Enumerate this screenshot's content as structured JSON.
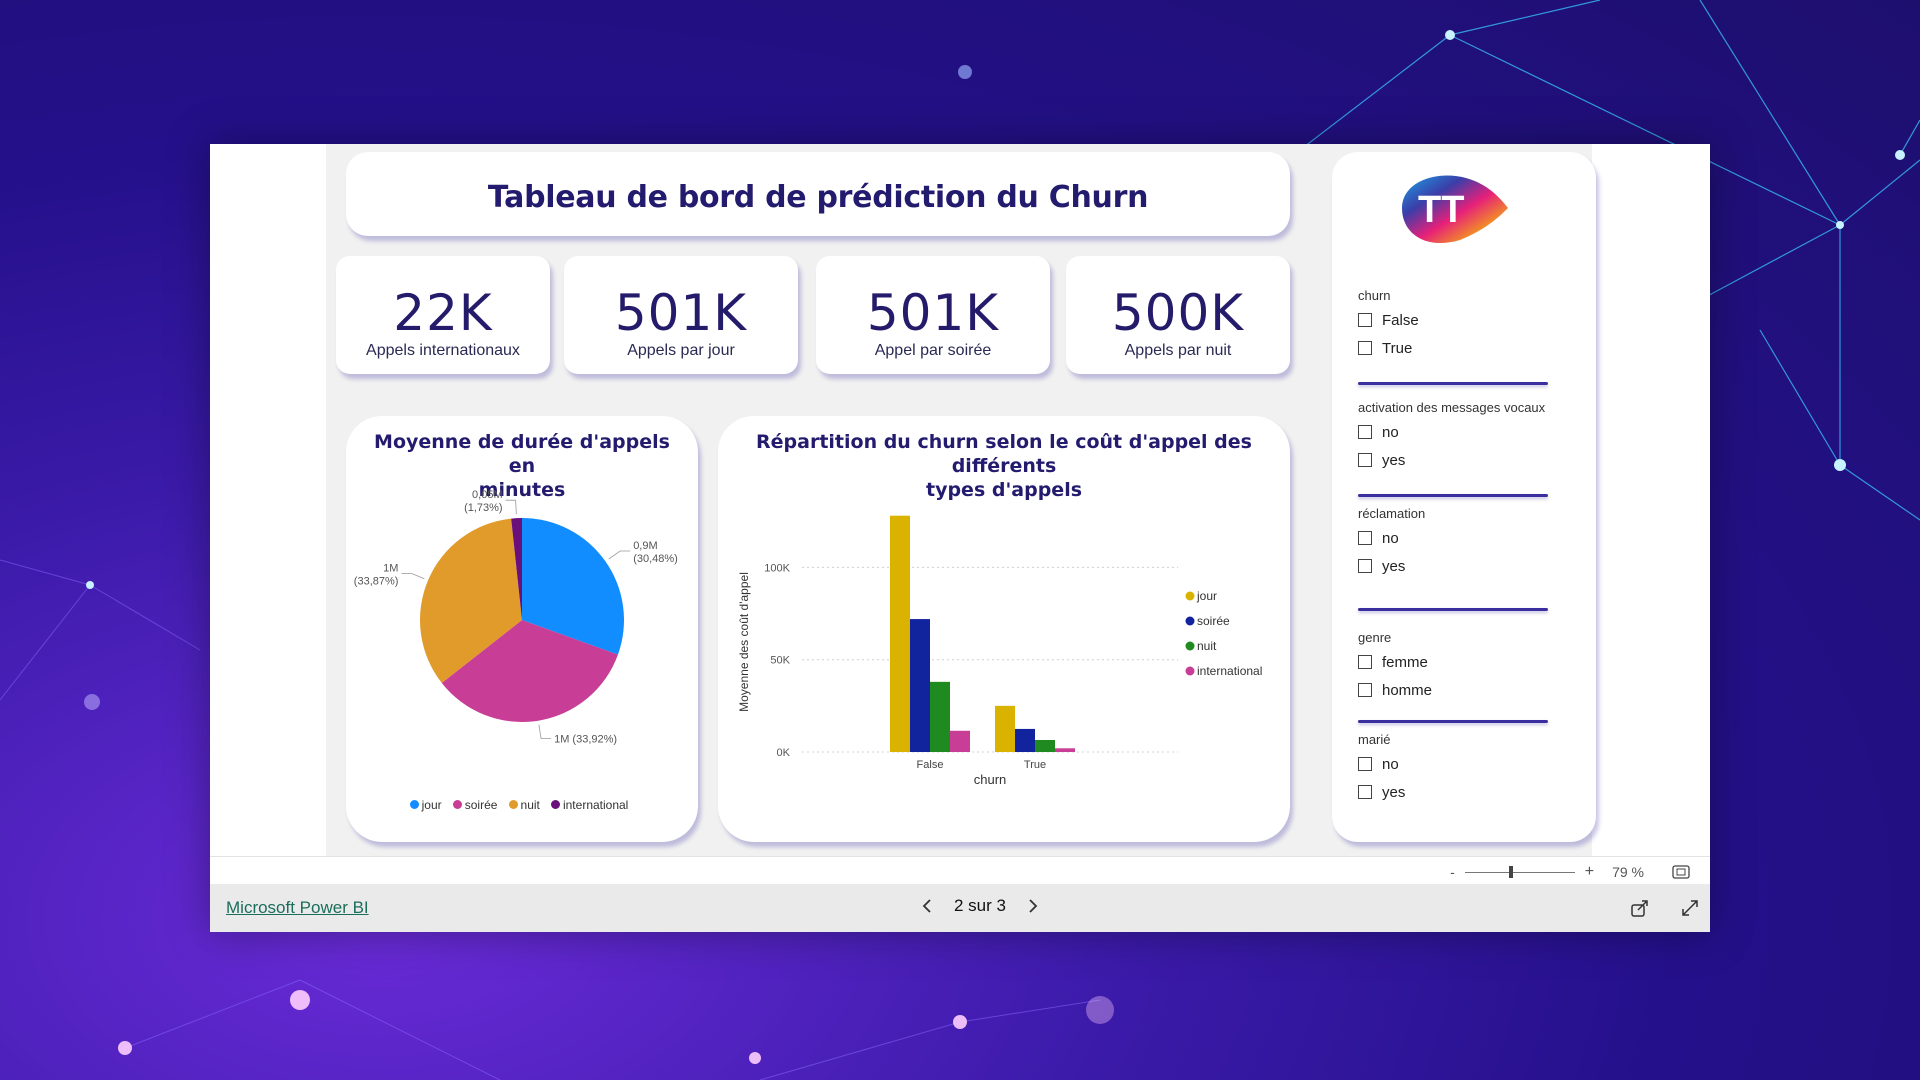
{
  "dashboard": {
    "title": "Tableau de bord de prédiction du Churn"
  },
  "kpis": [
    {
      "value": "22K",
      "label": "Appels internationaux"
    },
    {
      "value": "501K",
      "label": "Appels par jour"
    },
    {
      "value": "501K",
      "label": "Appel par soirée"
    },
    {
      "value": "500K",
      "label": "Appels par nuit"
    }
  ],
  "pie_card": {
    "title_line1": "Moyenne de durée d'appels en",
    "title_line2": "minutes"
  },
  "bar_card": {
    "title_line1": "Répartition du churn selon le coût d'appel des différents",
    "title_line2": "types d'appels"
  },
  "logo": {
    "text": "TT",
    "icon": "tunisie-telecom-logo"
  },
  "slicers": [
    {
      "title": "churn",
      "options": [
        "False",
        "True"
      ]
    },
    {
      "title": "activation des messages vocaux",
      "options": [
        "no",
        "yes"
      ]
    },
    {
      "title": "réclamation",
      "options": [
        "no",
        "yes"
      ]
    },
    {
      "title": "genre",
      "options": [
        "femme",
        "homme"
      ]
    },
    {
      "title": "marié",
      "options": [
        "no",
        "yes"
      ]
    }
  ],
  "footer": {
    "powerbi_link": "Microsoft Power BI",
    "page_indicator": "2 sur 3",
    "zoom_minus": "-",
    "zoom_plus": "+",
    "zoom_level": "79 %",
    "zoom_fraction": 0.4,
    "prev_icon": "chevron-left-icon",
    "next_icon": "chevron-right-icon",
    "share_icon": "share-icon",
    "fullscreen_icon": "expand-icon",
    "fit_icon": "fit-page-icon"
  },
  "colors": {
    "jour": "#118dff",
    "soiree": "#c83d95",
    "nuit": "#e09b2a",
    "international": "#6b0f7a",
    "bar_jour": "#d9b300",
    "bar_soiree": "#12239e",
    "bar_nuit": "#1f8a1f",
    "bar_international": "#c83d95",
    "title": "#231b6e"
  },
  "chart_data": [
    {
      "type": "pie",
      "title": "Moyenne de durée d'appels en minutes",
      "categories": [
        "jour",
        "soirée",
        "nuit",
        "international"
      ],
      "values": [
        0.9,
        1.0,
        1.0,
        0.05
      ],
      "percent": [
        30.48,
        33.92,
        33.87,
        1.73
      ],
      "data_labels": [
        "0,9M\n(30,48%)",
        "1M (33,92%)",
        "1M\n(33,87%)",
        "0,05M\n(1,73%)"
      ],
      "legend": [
        "jour",
        "soirée",
        "nuit",
        "international"
      ],
      "legend_position": "bottom"
    },
    {
      "type": "bar",
      "title": "Répartition du churn selon le coût d'appel des différents types d'appels",
      "xlabel": "churn",
      "ylabel": "Moyenne des coût d'appel",
      "categories": [
        "False",
        "True"
      ],
      "series": [
        {
          "name": "jour",
          "values": [
            128000,
            25000
          ]
        },
        {
          "name": "soirée",
          "values": [
            72000,
            12500
          ]
        },
        {
          "name": "nuit",
          "values": [
            38000,
            6500
          ]
        },
        {
          "name": "international",
          "values": [
            11500,
            2000
          ]
        }
      ],
      "yticks": [
        "0K",
        "50K",
        "100K"
      ],
      "ylim": [
        0,
        130000
      ],
      "grid": true,
      "legend_position": "right"
    }
  ]
}
